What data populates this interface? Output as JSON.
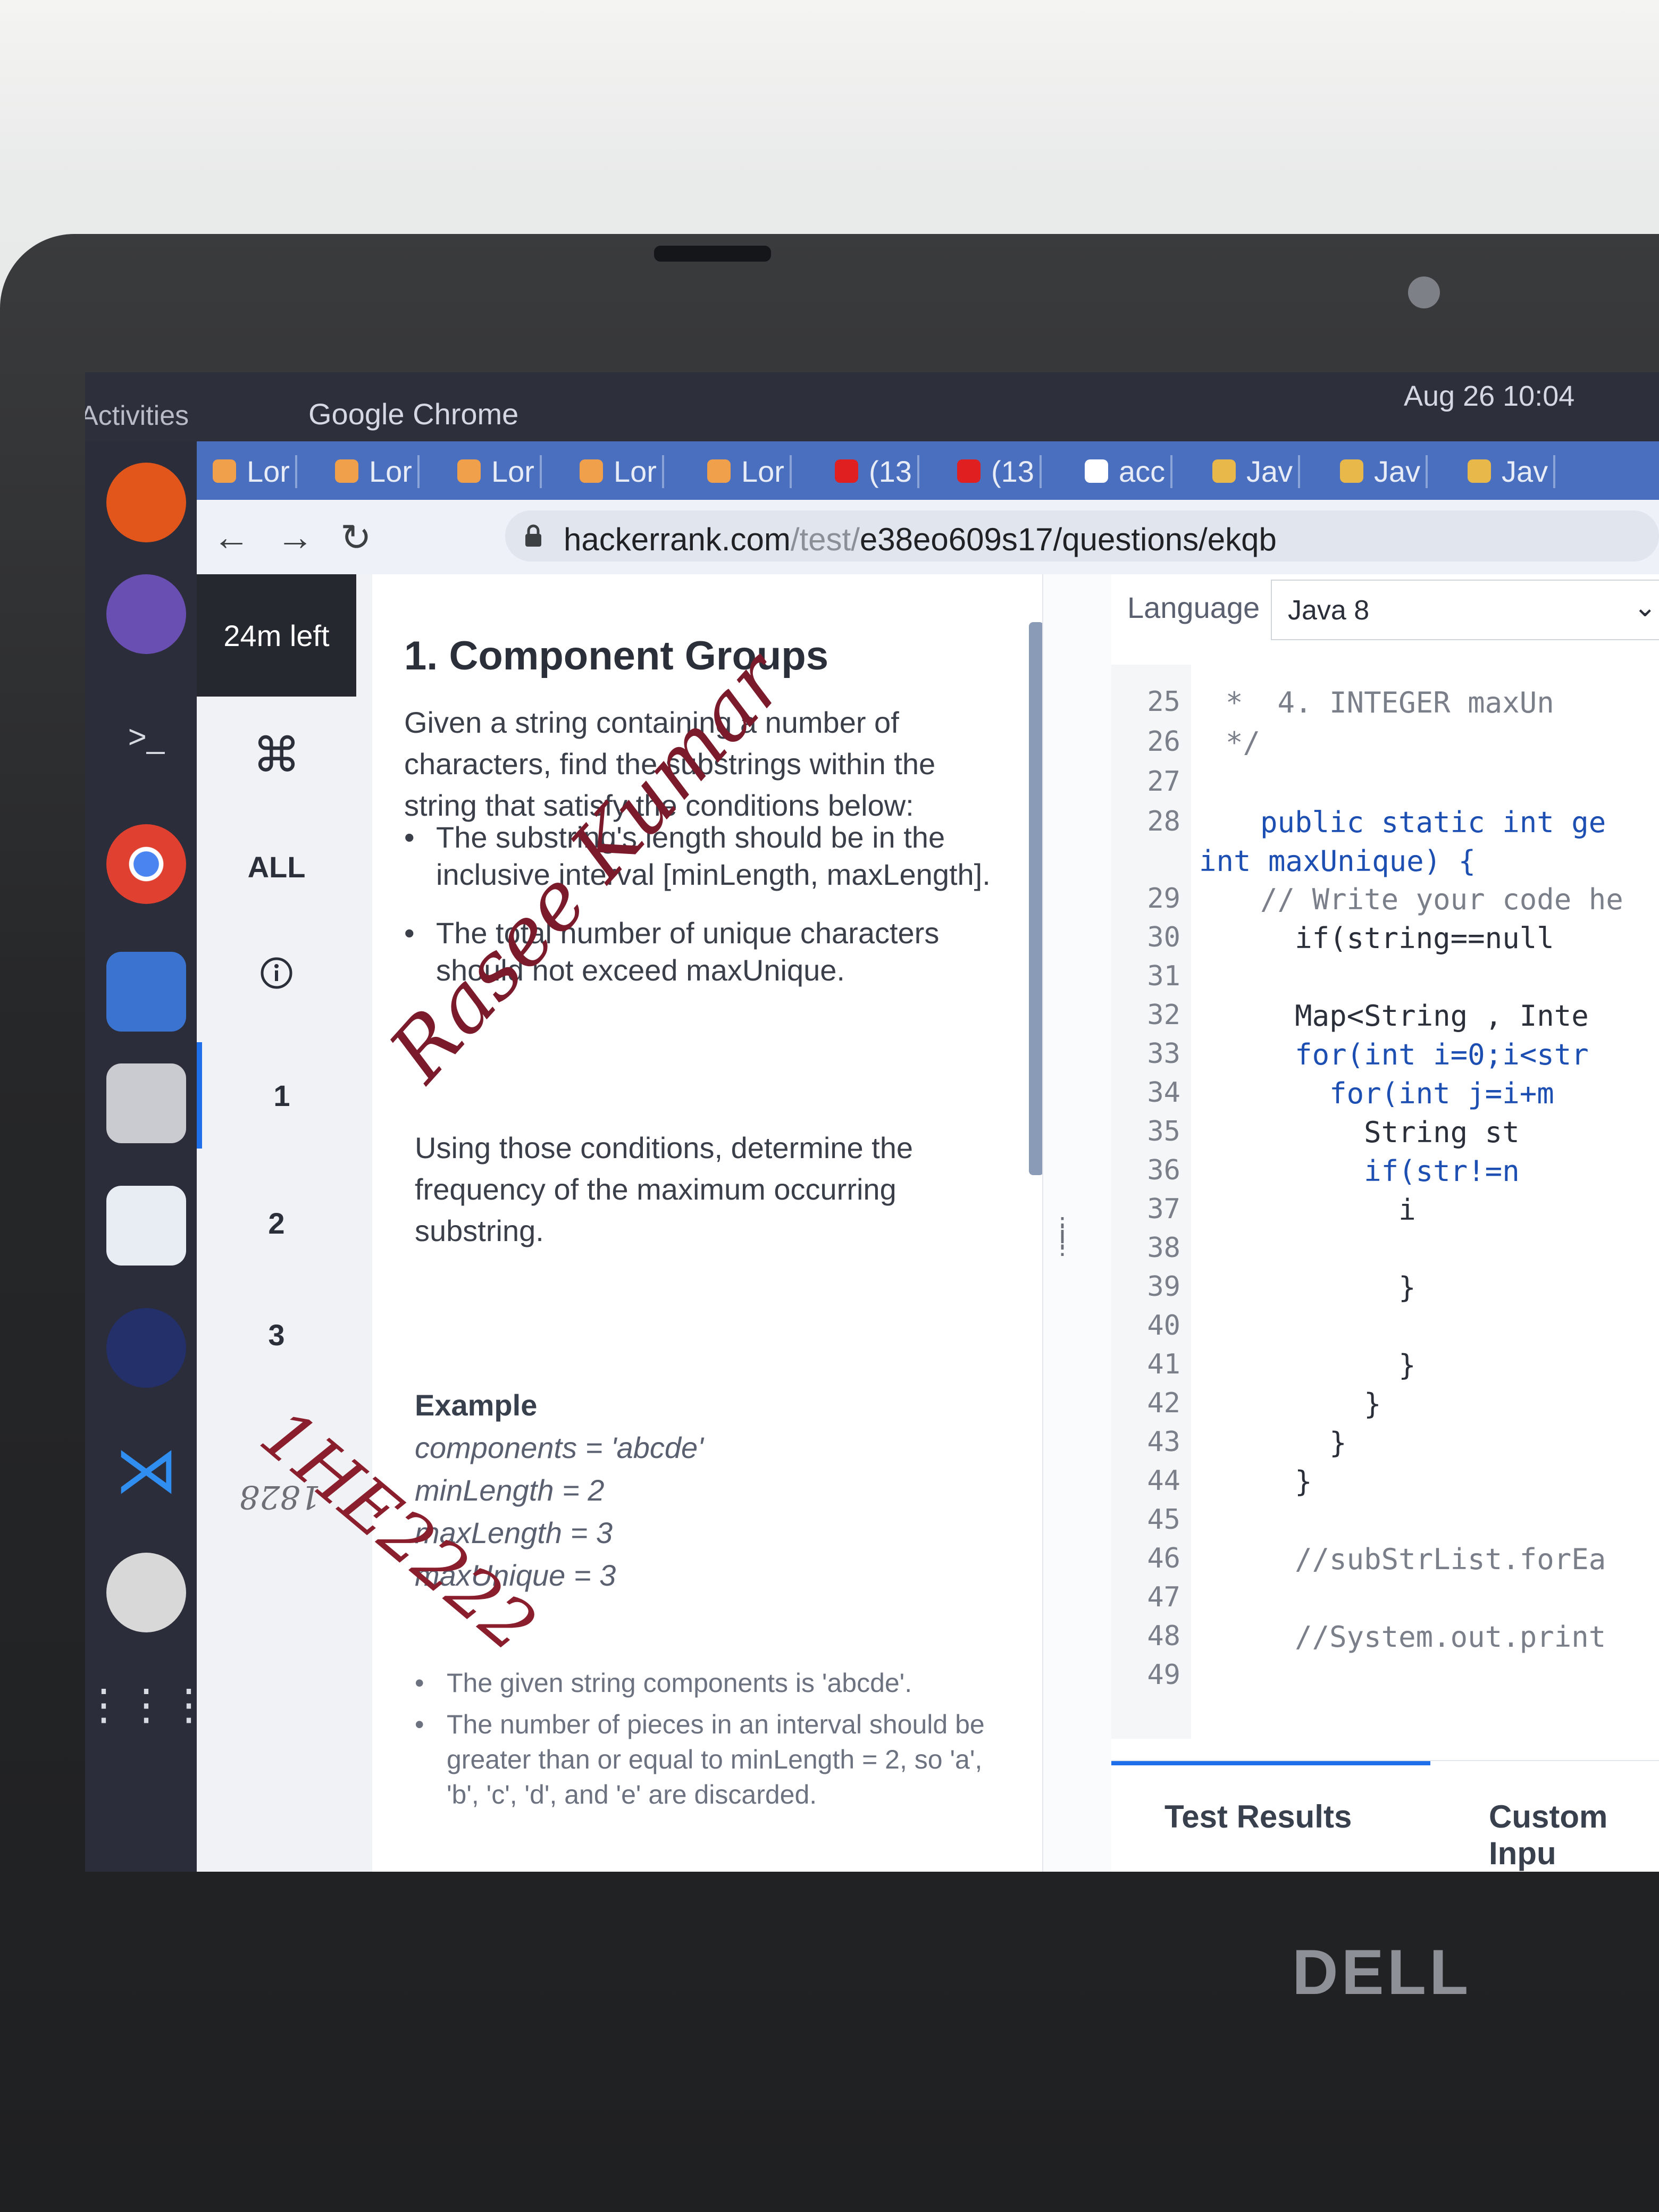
{
  "topbar": {
    "activities": "Activities",
    "app_name": "Google Chrome",
    "clock": "Aug 26  10:04"
  },
  "tabs": [
    {
      "label": "Lor",
      "icon": "leetcode"
    },
    {
      "label": "Lor",
      "icon": "leetcode"
    },
    {
      "label": "Lor",
      "icon": "leetcode"
    },
    {
      "label": "Lor",
      "icon": "leetcode"
    },
    {
      "label": "Lor",
      "icon": "leetcode"
    },
    {
      "label": "(13",
      "icon": "youtube"
    },
    {
      "label": "(13",
      "icon": "youtube"
    },
    {
      "label": "acc",
      "icon": "google"
    },
    {
      "label": "Jav",
      "icon": "java"
    },
    {
      "label": "Jav",
      "icon": "java"
    },
    {
      "label": "Jav",
      "icon": "java"
    }
  ],
  "address": {
    "host": "hackerrank.com",
    "path_dim": "/test/",
    "path": "e38eo609s17/questions/ekqb"
  },
  "rail": {
    "timer": "24m left",
    "all": "ALL",
    "q1": "1",
    "q2": "2",
    "q3": "3"
  },
  "problem": {
    "title": "1. Component Groups",
    "intro": "Given a string containing a number of characters, find the substrings within the string that satisfy the conditions below:",
    "bullets": [
      "The substring's length should be in the inclusive interval [minLength, maxLength].",
      "The total number of unique characters should not exceed maxUnique."
    ],
    "task": "Using those conditions, determine the frequency of the maximum occurring substring.",
    "example_title": "Example",
    "example_lines": [
      "components = 'abcde'",
      "minLength = 2",
      "maxLength = 3",
      "maxUnique = 3"
    ],
    "notes": [
      "The given string components is 'abcde'.",
      "The number of pieces in an interval should be greater than or equal to minLength = 2, so 'a', 'b', 'c', 'd', and 'e' are discarded."
    ]
  },
  "editor": {
    "language_label": "Language",
    "language": "Java 8",
    "lines": [
      {
        "n": "25",
        "text": "  *  4. INTEGER maxUn"
      },
      {
        "n": "26",
        "text": "  */"
      },
      {
        "n": "27",
        "text": ""
      },
      {
        "n": "28",
        "text": "    public static int ge"
      },
      {
        "n": "",
        "text": "int maxUnique) {"
      },
      {
        "n": "29",
        "text": "    // Write your code he"
      },
      {
        "n": "30",
        "text": "      if(string==null"
      },
      {
        "n": "31",
        "text": ""
      },
      {
        "n": "32",
        "text": "      Map<String , Inte"
      },
      {
        "n": "33",
        "text": "      for(int i=0;i<str"
      },
      {
        "n": "34",
        "text": "        for(int j=i+m"
      },
      {
        "n": "35",
        "text": "          String st"
      },
      {
        "n": "36",
        "text": "          if(str!=n"
      },
      {
        "n": "37",
        "text": "            i"
      },
      {
        "n": "38",
        "text": ""
      },
      {
        "n": "39",
        "text": "            }"
      },
      {
        "n": "40",
        "text": ""
      },
      {
        "n": "41",
        "text": "            }"
      },
      {
        "n": "42",
        "text": "          }"
      },
      {
        "n": "43",
        "text": "        }"
      },
      {
        "n": "44",
        "text": "      }"
      },
      {
        "n": "45",
        "text": ""
      },
      {
        "n": "46",
        "text": "      //subStrList.forEa"
      },
      {
        "n": "47",
        "text": ""
      },
      {
        "n": "48",
        "text": "      //System.out.print"
      },
      {
        "n": "49",
        "text": ""
      }
    ],
    "tab_results": "Test Results",
    "tab_custom": "Custom Inpu"
  },
  "annotations": {
    "signature": "Rasee Kumar",
    "stamp": "1HE2222",
    "mirror": "1828"
  },
  "brand": "DELL",
  "colors": {
    "accent": "#1f6feb",
    "tabstrip": "#4b6fbf",
    "dock": "#2b2d3a"
  }
}
